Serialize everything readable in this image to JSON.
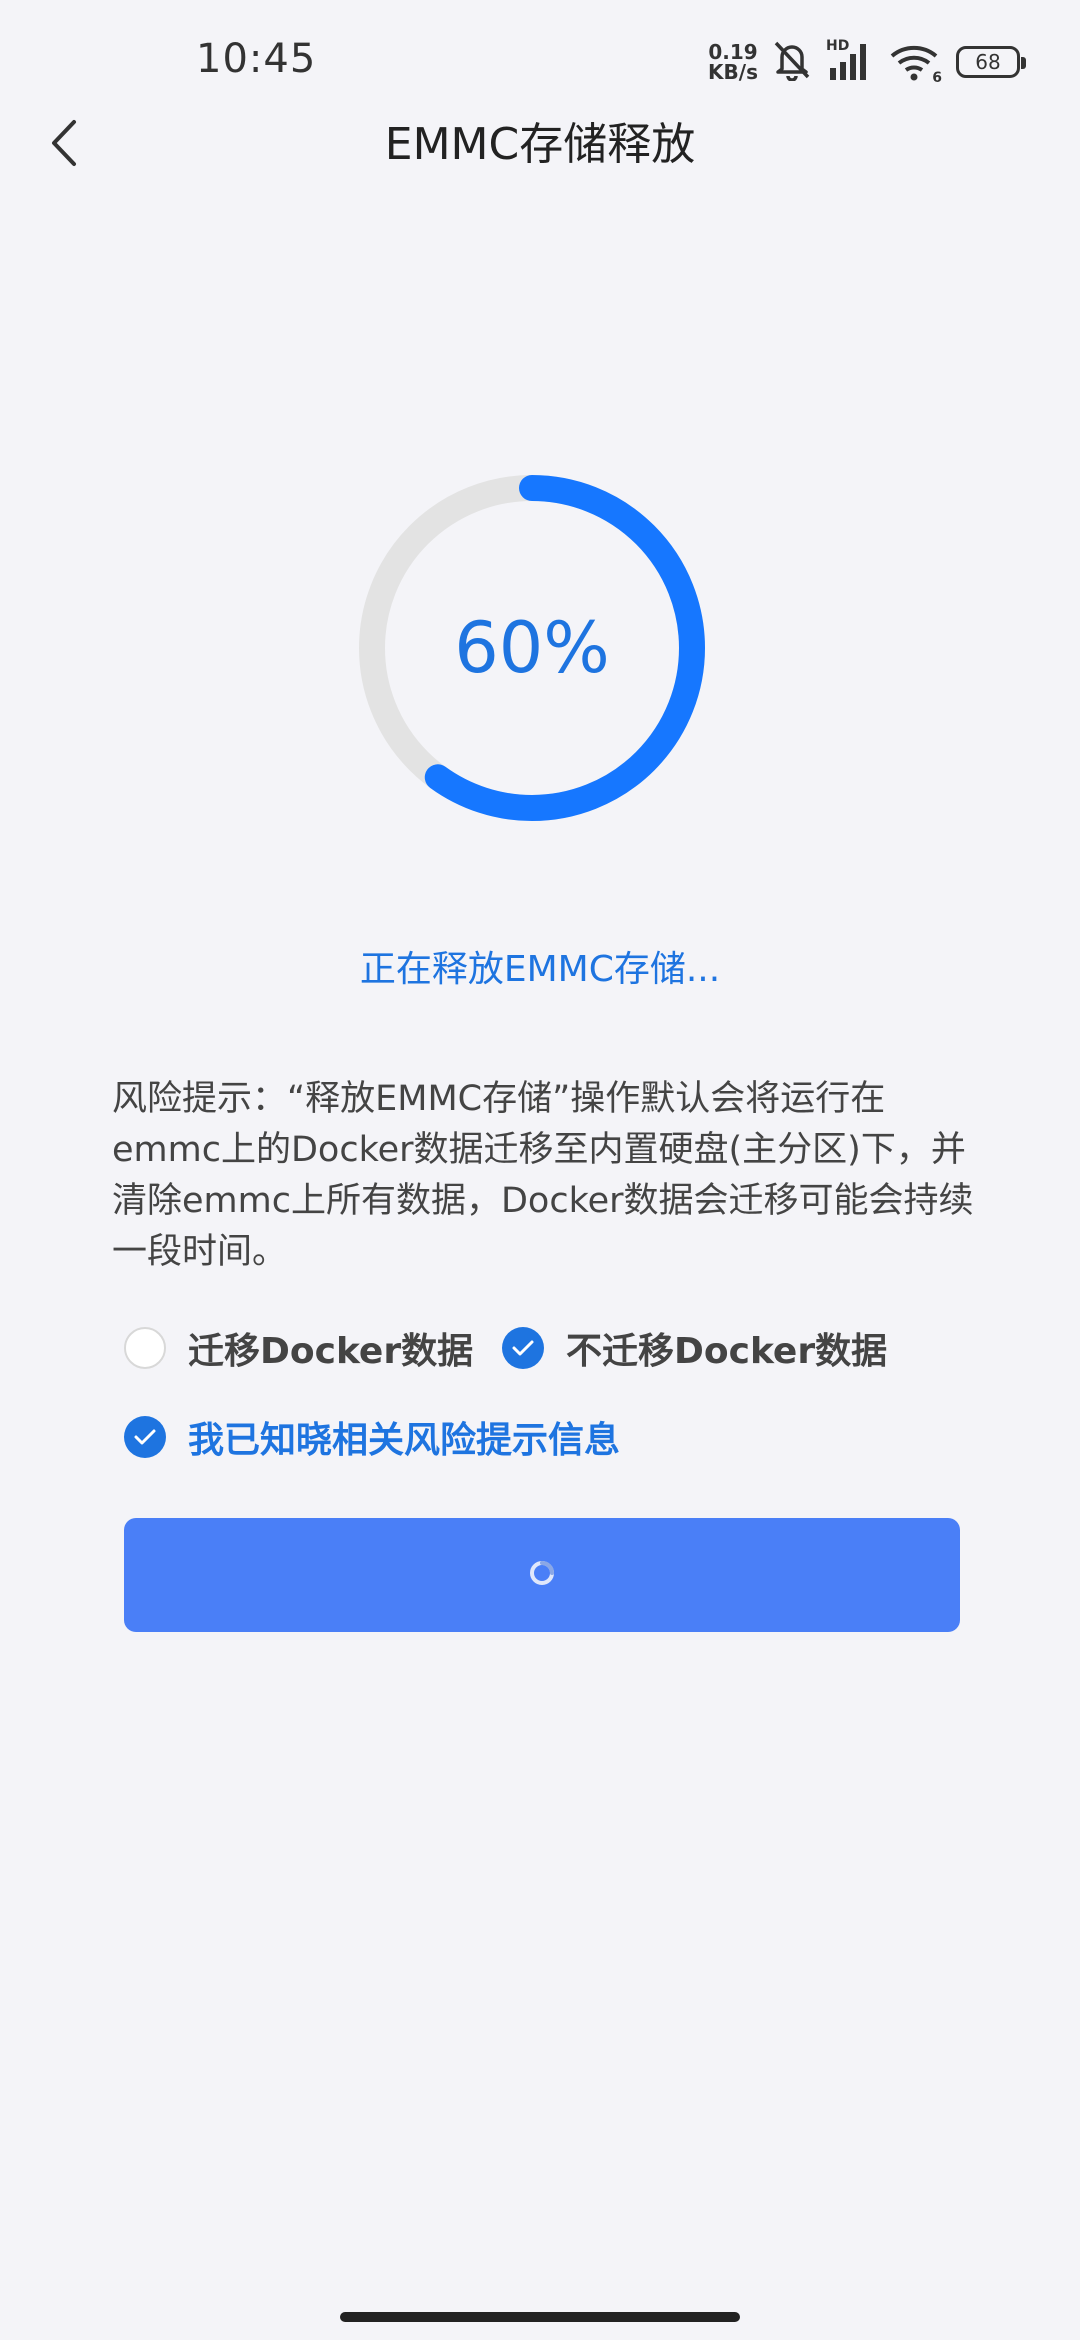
{
  "status_bar": {
    "time": "10:45",
    "net_speed_value": "0.19",
    "net_speed_unit": "KB/s",
    "signal_label": "HD",
    "wifi_label": "6",
    "battery": "68"
  },
  "header": {
    "title": "EMMC存储释放"
  },
  "progress": {
    "value": 0.6,
    "label": "60%",
    "color": "#1677ff",
    "track_color": "#e3e3e3"
  },
  "status_message": "正在释放EMMC存储...",
  "risk_notice": "风险提示：“释放EMMC存储”操作默认会将运行在emmc上的Docker数据迁移至内置硬盘(主分区)下，并清除emmc上所有数据，Docker数据会迁移可能会持续一段时间。",
  "options": {
    "migrate": {
      "label": "迁移Docker数据",
      "selected": false
    },
    "no_migrate": {
      "label": "不迁移Docker数据",
      "selected": true
    }
  },
  "acknowledge": {
    "label": "我已知晓相关风险提示信息",
    "checked": true
  },
  "button": {
    "state": "loading",
    "color": "#4a7ff7"
  }
}
